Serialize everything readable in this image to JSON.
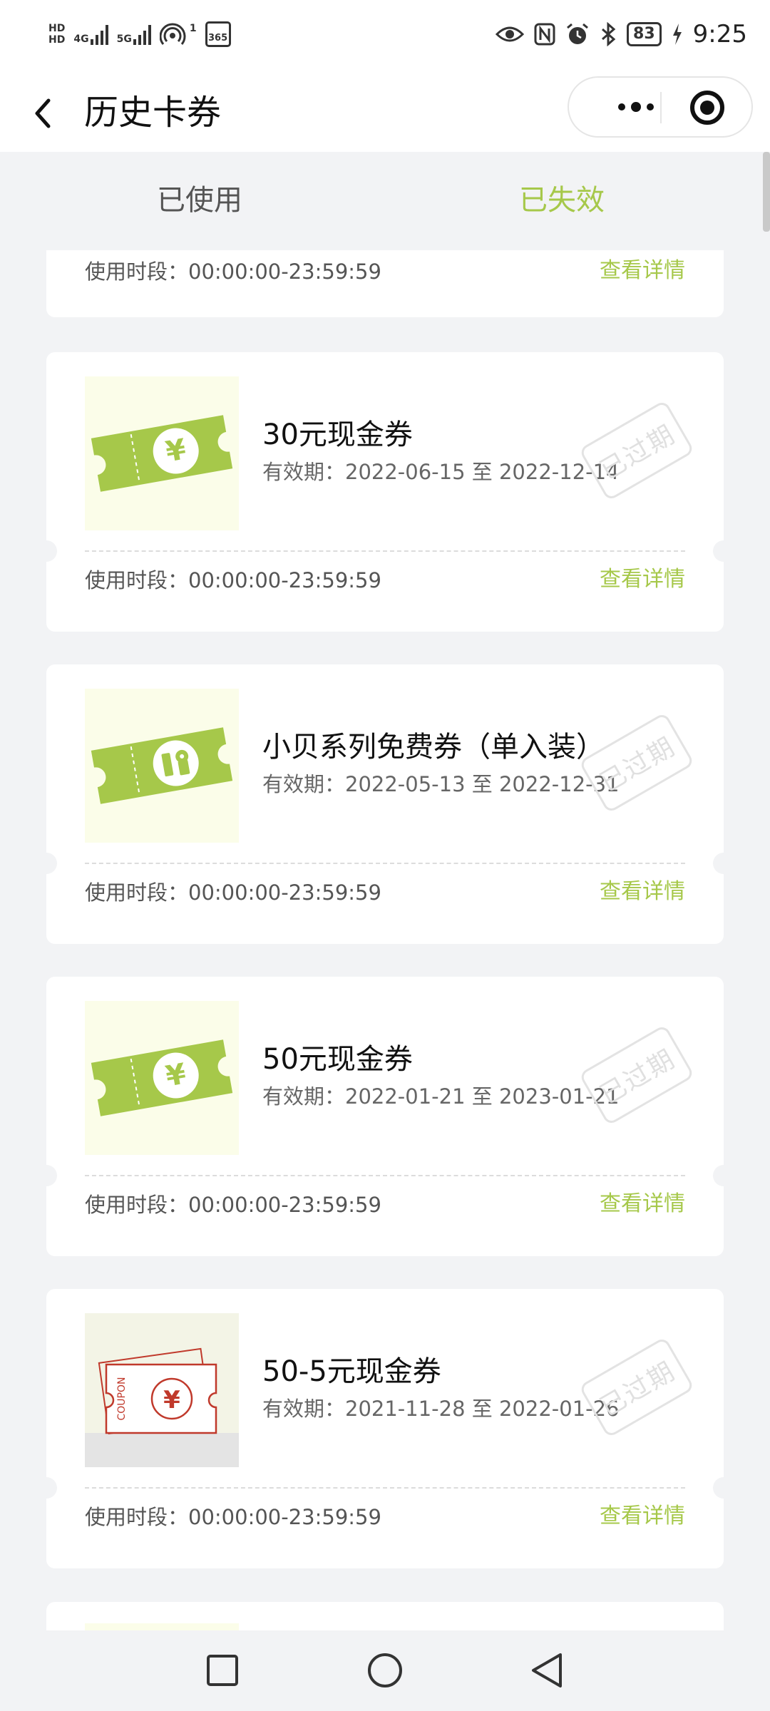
{
  "status_bar": {
    "left_labels": [
      "HD",
      "4G",
      "5G",
      "1",
      "365"
    ],
    "battery": "83",
    "time": "9:25",
    "icons": [
      "eye-icon",
      "nfc-icon",
      "alarm-icon",
      "bluetooth-icon",
      "charging-icon"
    ]
  },
  "nav": {
    "title": "历史卡券",
    "back_icon": "chevron-left-icon",
    "menu_icon": "more-dots-icon",
    "close_icon": "target-icon"
  },
  "tabs": {
    "used": "已使用",
    "expired": "已失效",
    "active": "expired"
  },
  "colors": {
    "accent": "#a6c84a",
    "background": "#f2f3f5",
    "coupon_red": "#c0392b"
  },
  "partial_top": {
    "time_range": "使用时段：00:00:00-23:59:59",
    "detail": "查看详情"
  },
  "coupons": [
    {
      "title": "30元现金券",
      "validity": "有效期：2022-06-15 至 2022-12-14",
      "stamp": "已过期",
      "time_range": "使用时段：00:00:00-23:59:59",
      "detail": "查看详情",
      "icon": "yen-ticket-icon"
    },
    {
      "title": "小贝系列免费券（单入装）",
      "validity": "有效期：2022-05-13 至 2022-12-31",
      "stamp": "已过期",
      "time_range": "使用时段：00:00:00-23:59:59",
      "detail": "查看详情",
      "icon": "gift-ticket-icon"
    },
    {
      "title": "50元现金券",
      "validity": "有效期：2022-01-21 至 2023-01-21",
      "stamp": "已过期",
      "time_range": "使用时段：00:00:00-23:59:59",
      "detail": "查看详情",
      "icon": "yen-ticket-icon"
    },
    {
      "title": "50-5元现金券",
      "validity": "有效期：2021-11-28 至 2022-01-26",
      "stamp": "已过期",
      "time_range": "使用时段：00:00:00-23:59:59",
      "detail": "查看详情",
      "icon": "coupon-card-icon",
      "coupon_label": "COUPON"
    }
  ],
  "android_nav": [
    "recent-apps-icon",
    "home-icon",
    "back-icon"
  ]
}
